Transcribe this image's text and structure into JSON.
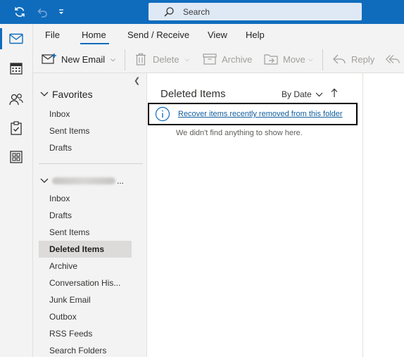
{
  "titlebar": {
    "search_placeholder": "Search",
    "icons": [
      "sync-icon",
      "undo-icon",
      "customize-toolbar-icon",
      "search-icon"
    ]
  },
  "appbar": {
    "items": [
      "mail-icon",
      "calendar-icon",
      "people-icon",
      "tasks-icon",
      "apps-icon"
    ]
  },
  "menu": {
    "tabs": [
      "File",
      "Home",
      "Send / Receive",
      "View",
      "Help"
    ],
    "active_tab": "Home"
  },
  "ribbon": {
    "new_email": "New Email",
    "delete": "Delete",
    "archive": "Archive",
    "move": "Move",
    "reply": "Reply"
  },
  "folders": {
    "favorites_label": "Favorites",
    "favorites": [
      "Inbox",
      "Sent Items",
      "Drafts"
    ],
    "account_suffix": "...",
    "account_folders": [
      "Inbox",
      "Drafts",
      "Sent Items",
      "Deleted Items",
      "Archive",
      "Conversation His...",
      "Junk Email",
      "Outbox",
      "RSS Feeds",
      "Search Folders"
    ],
    "selected": "Deleted Items"
  },
  "message_list": {
    "title": "Deleted Items",
    "sort_label": "By Date",
    "recover_link": "Recover items recently removed from this folder",
    "empty_text": "We didn't find anything to show here."
  },
  "colors": {
    "accent": "#0f6cbd",
    "titlebar": "#0f6cbd",
    "link": "#0f5c9e",
    "selected_folder_bg": "#dddbda"
  }
}
